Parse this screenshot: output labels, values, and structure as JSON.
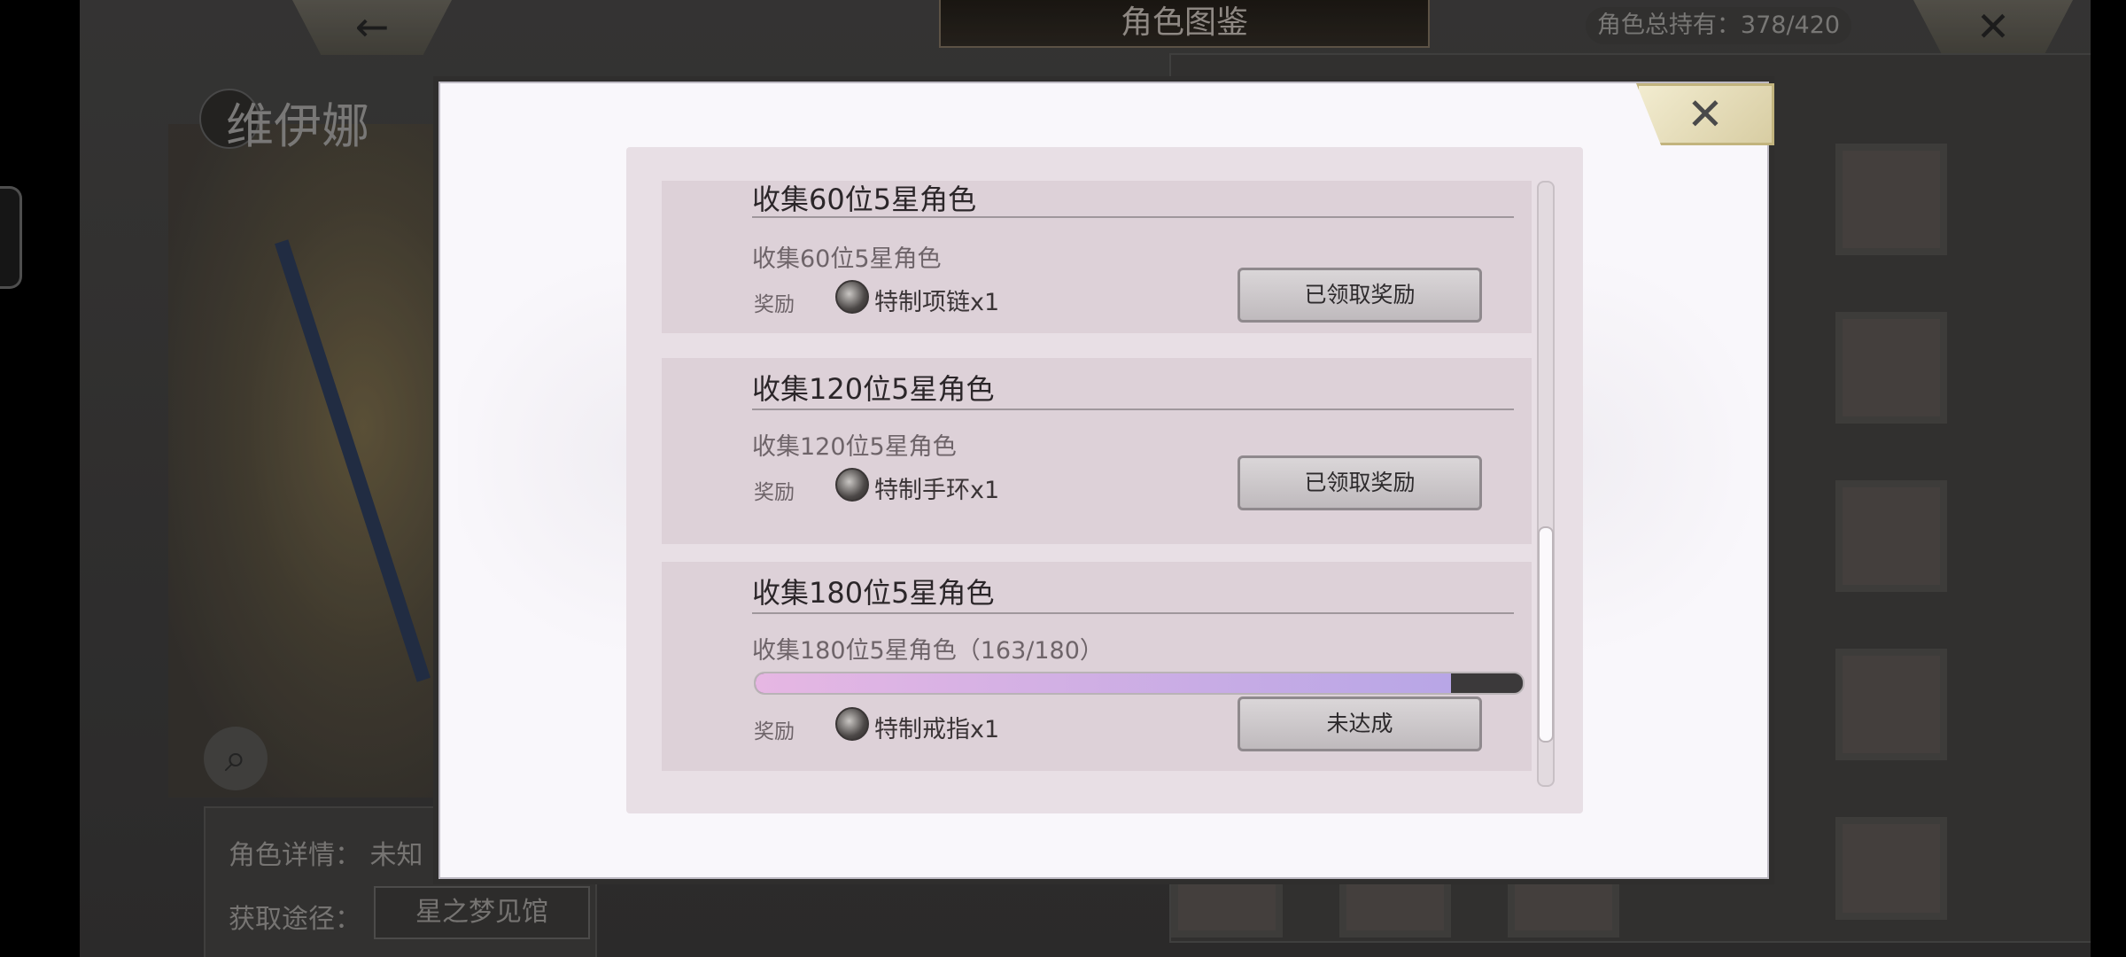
{
  "background": {
    "title": "角色图鉴",
    "owned_label": "角色总持有：378/420",
    "back_icon": "←",
    "close_icon": "✕",
    "character_name": "维伊娜",
    "detail_label": "角色详情：",
    "detail_value": "未知",
    "source_label": "获取途径：",
    "source_value": "星之梦见馆"
  },
  "modal": {
    "close_icon": "✕",
    "items": [
      {
        "title": "收集60位5星角色",
        "desc": "收集60位5星角色",
        "reward_label": "奖励",
        "reward_name": "特制项链x1",
        "button": "已领取奖励"
      },
      {
        "title": "收集120位5星角色",
        "desc": "收集120位5星角色",
        "reward_label": "奖励",
        "reward_name": "特制手环x1",
        "button": "已领取奖励"
      },
      {
        "title": "收集180位5星角色",
        "desc": "收集180位5星角色（163/180）",
        "reward_label": "奖励",
        "reward_name": "特制戒指x1",
        "button": "未达成",
        "progress": 0.906
      }
    ]
  }
}
